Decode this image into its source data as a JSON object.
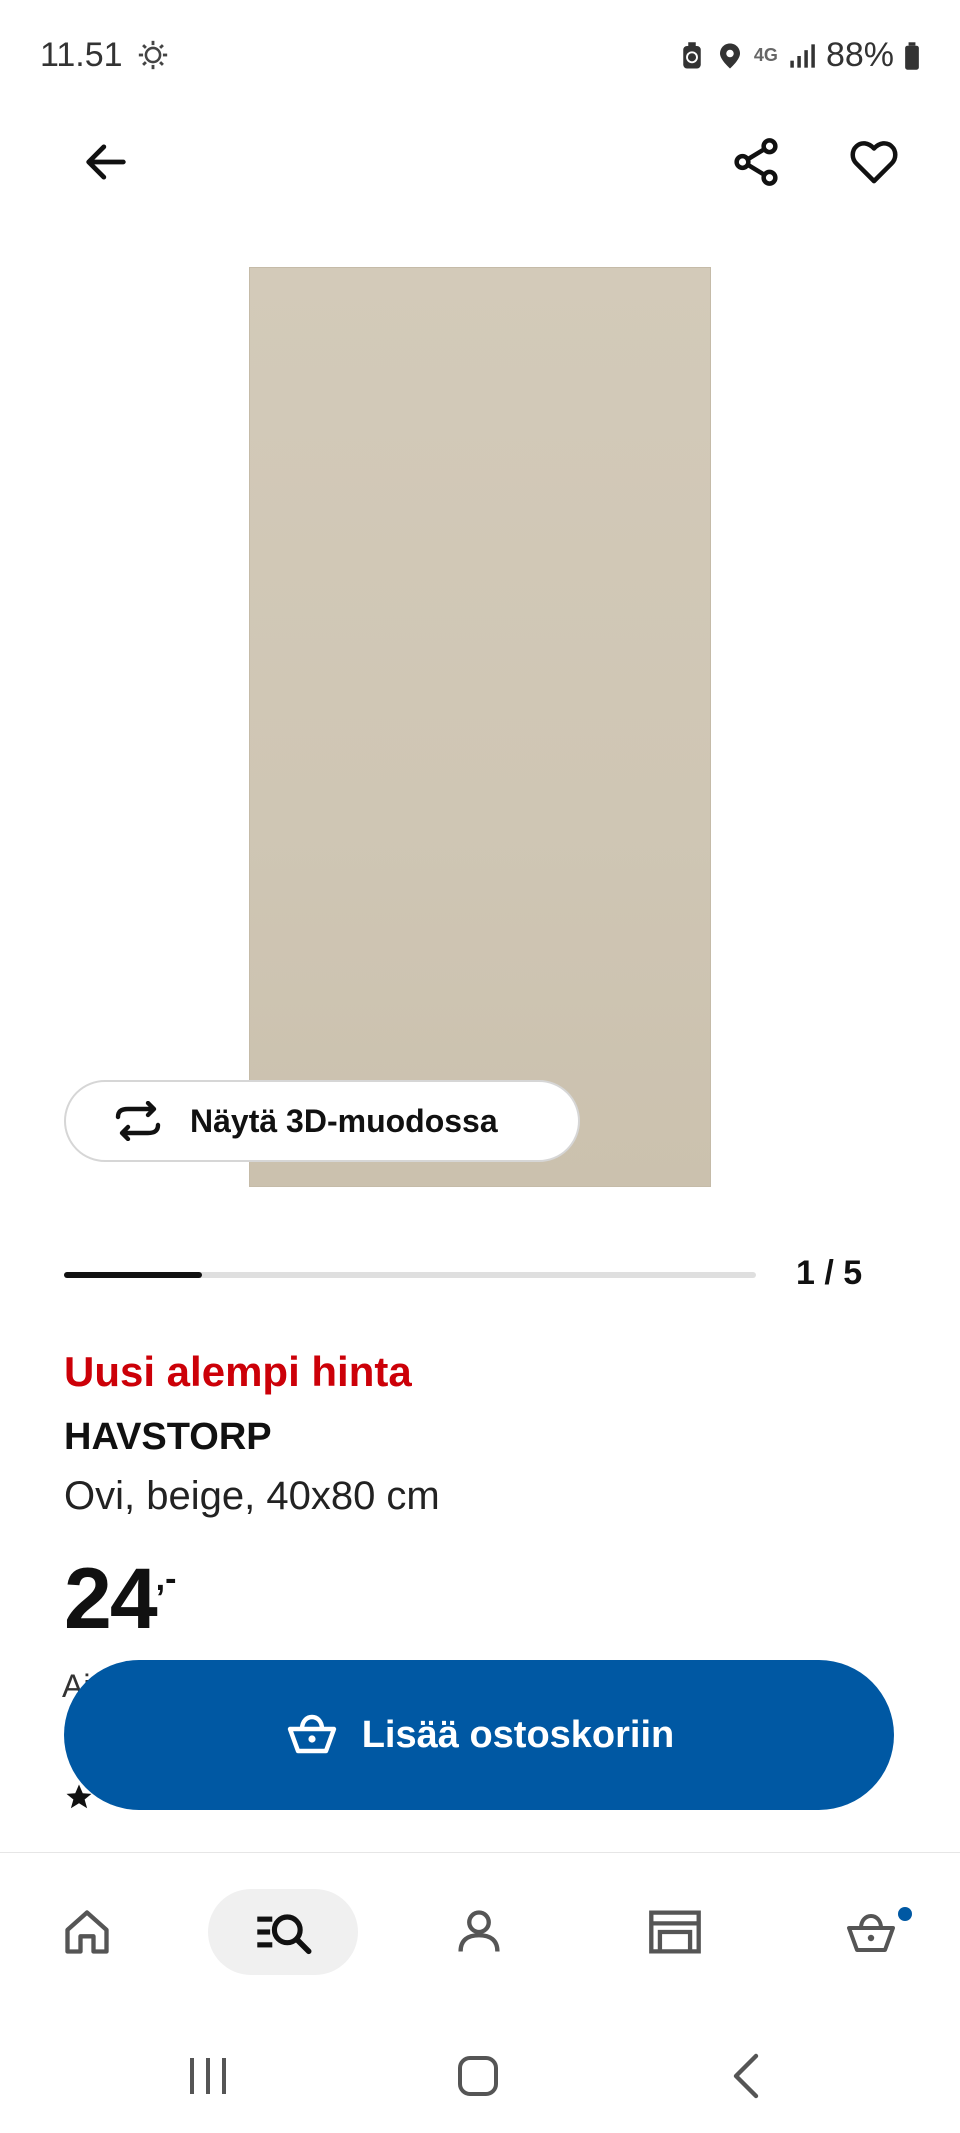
{
  "status_bar": {
    "time": "11.51",
    "network": "4G",
    "battery": "88%"
  },
  "icons": {
    "back": "arrow-left-icon",
    "share": "share-icon",
    "favorite": "heart-icon",
    "rotate": "rotate-3d-icon",
    "cart": "shopping-basket-icon",
    "nav_home": "home-icon",
    "nav_search": "search-list-icon",
    "nav_profile": "person-icon",
    "nav_store": "store-icon",
    "nav_cart": "basket-icon"
  },
  "product": {
    "image_color": "#cfc6b4",
    "view_3d_label": "Näytä 3D-muodossa",
    "carousel_counter": "1 / 5",
    "carousel_progress": 0.2,
    "price_tag": "Uusi alempi hinta",
    "name": "HAVSTORP",
    "description": "Ovi, beige, 40x80 cm",
    "price_main": "24",
    "price_suffix": ",-",
    "peek_text": "Ai"
  },
  "actions": {
    "add_to_cart_label": "Lisää ostoskoriin"
  },
  "colors": {
    "brand_blue": "#0058a3",
    "price_red": "#cc0008",
    "text": "#111111"
  }
}
